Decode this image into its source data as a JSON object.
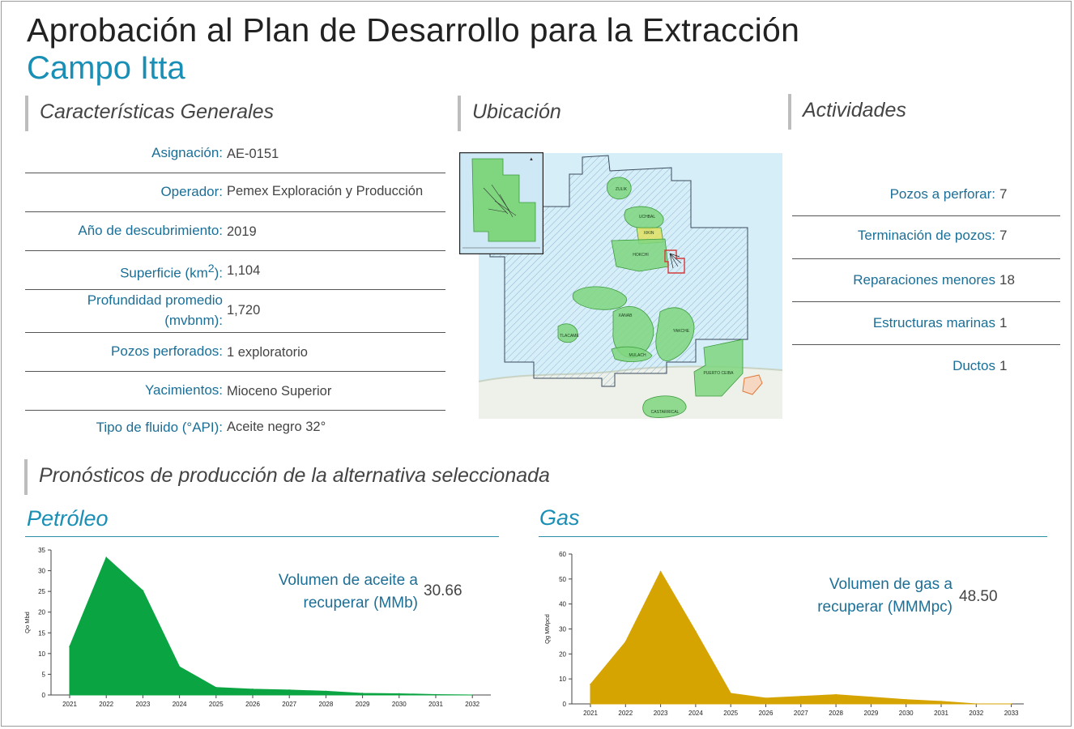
{
  "header": {
    "title": "Aprobación al Plan de Desarrollo para la Extracción",
    "subtitle": "Campo Itta"
  },
  "sections": {
    "general": "Características Generales",
    "location": "Ubicación",
    "activities": "Actividades",
    "forecast": "Pronósticos de producción de la alternativa seleccionada"
  },
  "general_items": [
    {
      "label": "Asignación:",
      "value": "AE-0151"
    },
    {
      "label": "Operador:",
      "value": "Pemex Exploración y Producción"
    },
    {
      "label": "Año  de descubrimiento:",
      "value": "2019"
    },
    {
      "label_html": "Superficie (km<sup>2</sup>):",
      "value": "1,104"
    },
    {
      "label": "Profundidad promedio (mvbnm):",
      "value": "1,720"
    },
    {
      "label": "Pozos perforados:",
      "value": "1 exploratorio"
    },
    {
      "label": "Yacimientos:",
      "value": "Mioceno Superior"
    },
    {
      "label": "Tipo de fluido (°API):",
      "value": "Aceite negro 32°"
    }
  ],
  "activities": [
    {
      "label": "Pozos a perforar:",
      "value": "7"
    },
    {
      "label": "Terminación de pozos:",
      "value": "7"
    },
    {
      "label": "Reparaciones menores",
      "value": "18"
    },
    {
      "label": "Estructuras marinas",
      "value": "1"
    },
    {
      "label": "Ductos",
      "value": "1"
    }
  ],
  "map": {
    "field_labels": [
      "ZULIK",
      "UCHBAL",
      "XIKIN",
      "HOKCHI",
      "XANAB",
      "TLACAME",
      "YAKCHE",
      "MULACH",
      "PUERTO CEIBA",
      "CASTARRICAL"
    ],
    "colors": {
      "water": "#d6eef8",
      "hatch": "#8fb7d6",
      "field": "#7fd67f",
      "field_edge": "#3c9a3c",
      "highlight": "#d43b3b"
    }
  },
  "oil": {
    "heading": "Petróleo",
    "volume_label": "Volumen de aceite a recuperar (MMb)",
    "volume_value": "30.66",
    "color": "#0aa542"
  },
  "gas": {
    "heading": "Gas",
    "volume_label": "Volumen de gas a recuperar (MMMpc)",
    "volume_value": "48.50",
    "color": "#d6a400"
  },
  "chart_data": [
    {
      "type": "area",
      "title": "Petróleo",
      "ylabel": "Qo Mbd",
      "xlabel": "",
      "x": [
        "2021",
        "2022",
        "2023",
        "2024",
        "2025",
        "2026",
        "2027",
        "2028",
        "2029",
        "2030",
        "2031",
        "2032"
      ],
      "yticks": [
        "0",
        "5",
        "10",
        "15",
        "20",
        "25",
        "30",
        "35"
      ],
      "ylim": [
        0,
        35
      ],
      "series": [
        {
          "values": [
            11.7,
            33.2,
            25.2,
            6.8,
            1.8,
            1.4,
            1.2,
            0.9,
            0.4,
            0.3,
            0.1,
            0
          ]
        }
      ],
      "grid": false
    },
    {
      "type": "area",
      "title": "Gas",
      "ylabel": "Qg MMpcd",
      "xlabel": "",
      "x": [
        "2021",
        "2022",
        "2023",
        "2024",
        "2025",
        "2026",
        "2027",
        "2028",
        "2029",
        "2030",
        "2031",
        "2032",
        "2033"
      ],
      "yticks": [
        "0",
        "10",
        "20",
        "30",
        "40",
        "50",
        "60"
      ],
      "ylim": [
        0,
        60
      ],
      "series": [
        {
          "values": [
            7.8,
            24.8,
            53.0,
            29.0,
            4.2,
            2.3,
            3.0,
            3.7,
            2.7,
            1.7,
            1.0,
            0,
            0
          ]
        }
      ],
      "grid": false
    }
  ]
}
